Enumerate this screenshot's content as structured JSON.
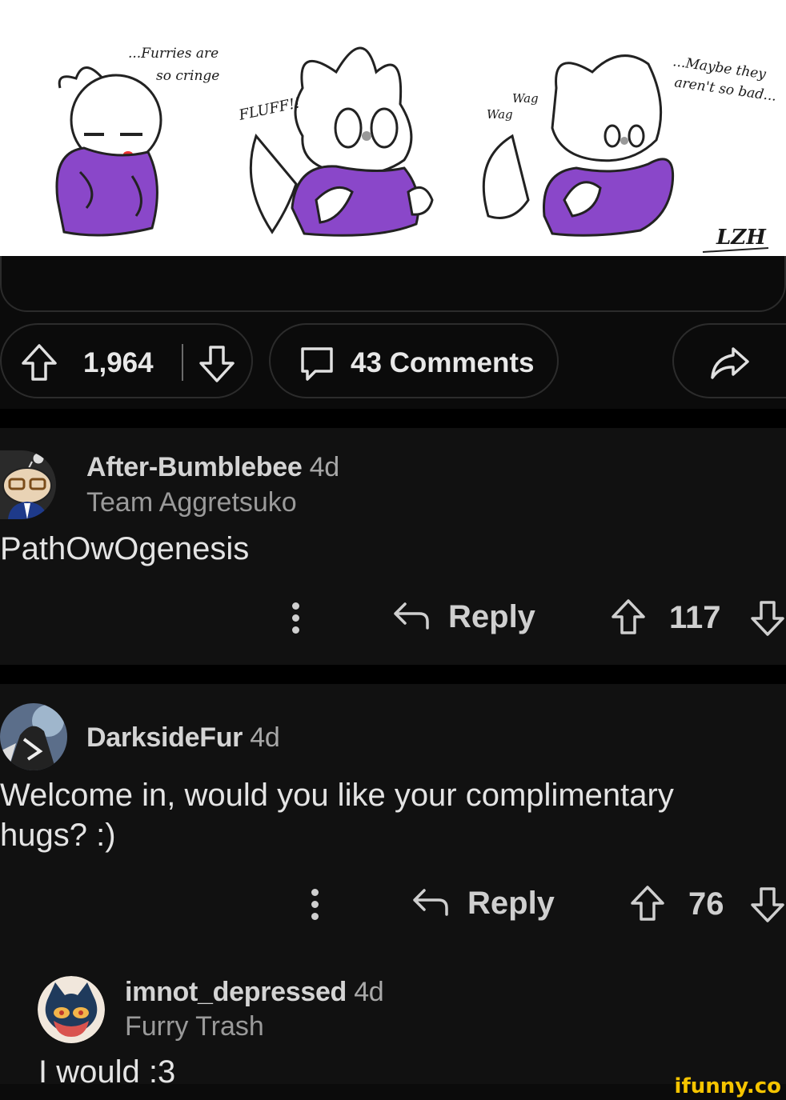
{
  "comic": {
    "panel1_text": [
      "...Furries are",
      "so cringe"
    ],
    "panel2_text": "FLUFF!!",
    "panel3_wag": [
      "Wag",
      "Wag"
    ],
    "panel3_text": [
      "...Maybe they",
      "aren't so bad..."
    ],
    "signature": "LZH"
  },
  "post_actions": {
    "upvote_count": "1,964",
    "comments_label": "43 Comments"
  },
  "comments": [
    {
      "username": "After-Bumblebee",
      "age": "4d",
      "flair": "Team Aggretsuko",
      "body": "PathOwOgenesis",
      "reply_label": "Reply",
      "score": "117"
    },
    {
      "username": "DarksideFur",
      "age": "4d",
      "flair": "",
      "body": "Welcome in, would you like your complimentary hugs? :)",
      "reply_label": "Reply",
      "score": "76"
    },
    {
      "username": "imnot_depressed",
      "age": "4d",
      "flair": "Furry Trash",
      "body": "I would :3"
    }
  ],
  "watermark": "ifunny.co",
  "colors": {
    "background": "#0b0b0b",
    "comment_bg": "#111111",
    "character_purple": "#8a47c9",
    "watermark": "#f5c400"
  }
}
